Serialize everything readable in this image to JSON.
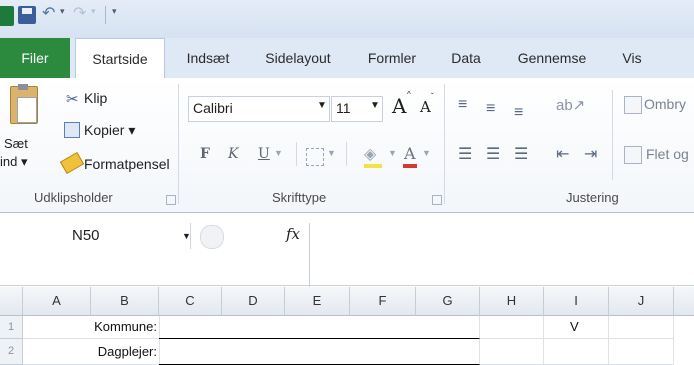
{
  "quick_access": {
    "undo": "↶",
    "redo": "↷",
    "dropdown": "▾",
    "customize": "▾"
  },
  "tabs": [
    "Filer",
    "Startside",
    "Indsæt",
    "Sidelayout",
    "Formler",
    "Data",
    "Gennemse",
    "Vis"
  ],
  "clipboard": {
    "paste_line1": "Sæt",
    "paste_line2": "ind ▾",
    "cut": "Klip",
    "copy": "Kopier ▾",
    "format_painter": "Formatpensel",
    "group_label": "Udklipsholder"
  },
  "font": {
    "font_name": "Calibri",
    "font_size": "11",
    "grow": "A",
    "shrink": "A",
    "bold": "F",
    "italic": "K",
    "underline": "U",
    "font_color": "A",
    "group_label": "Skrifttype"
  },
  "alignment": {
    "wrap_text": "Ombry",
    "merge": "Flet og",
    "group_label": "Justering"
  },
  "formula_bar": {
    "name_box": "N50",
    "fx": "fx"
  },
  "grid": {
    "columns": [
      "A",
      "B",
      "C",
      "D",
      "E",
      "F",
      "G",
      "H",
      "I",
      "J"
    ],
    "rows": [
      {
        "num": "1",
        "b": "Kommune:",
        "i": "V"
      },
      {
        "num": "2",
        "b": "Dagplejer:",
        "i": ""
      }
    ]
  },
  "colors": {
    "file_tab": "#2b8a3e",
    "ribbon": "#ffffff",
    "tab_bar": "#dfe8f5"
  }
}
